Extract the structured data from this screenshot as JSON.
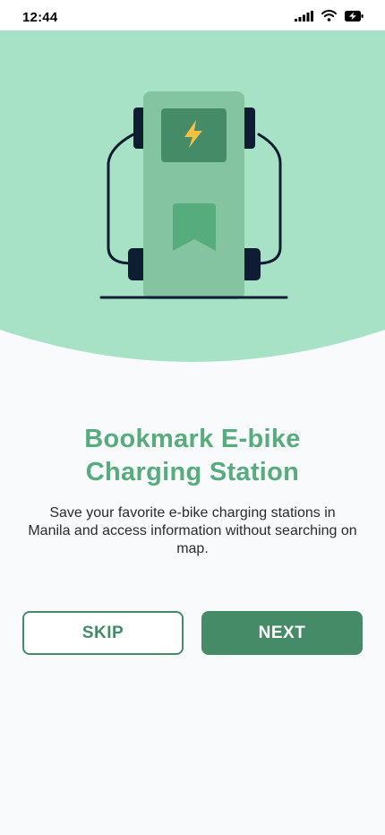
{
  "status_bar": {
    "time": "12:44",
    "icons": [
      "cellular-signal-icon",
      "wifi-icon",
      "battery-charging-icon"
    ]
  },
  "onboarding": {
    "illustration": "ev-charging-station-bookmark-illustration",
    "title_line1": "Bookmark E-bike",
    "title_line2": "Charging Station",
    "subtitle": "Save your favorite e-bike charging stations in Manila and access information without searching on map."
  },
  "actions": {
    "skip_label": "SKIP",
    "next_label": "NEXT"
  },
  "colors": {
    "hero_background": "#a8e2c6",
    "page_background": "#f8fafc",
    "primary": "#458b68",
    "title": "#57ac7e",
    "accent_bolt": "#f5c042",
    "outline": "#0f1d33"
  }
}
